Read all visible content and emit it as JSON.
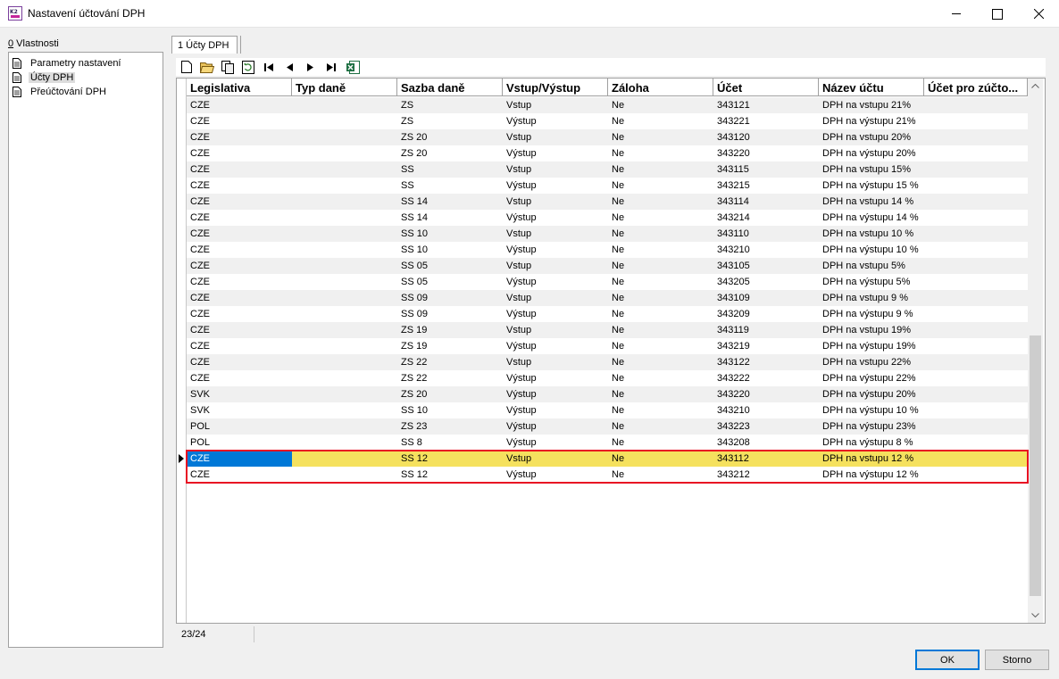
{
  "window": {
    "title": "Nastavení účtování DPH",
    "icon": "k2-app-icon"
  },
  "left_panel": {
    "header_accel": "0",
    "header_text": " Vlastnosti",
    "items": [
      {
        "label": "Parametry nastavení",
        "icon": "document-icon",
        "selected": false
      },
      {
        "label": "Účty DPH",
        "icon": "document-icon",
        "selected": true
      },
      {
        "label": "Přeúčtování DPH",
        "icon": "document-icon",
        "selected": false
      }
    ]
  },
  "tab": {
    "label": "1 Účty DPH"
  },
  "toolbar": {
    "icons": [
      "new-document-icon",
      "open-folder-icon",
      "copy-icon",
      "refresh-icon",
      "first-record-icon",
      "previous-record-icon",
      "next-record-icon",
      "last-record-icon",
      "excel-export-icon"
    ]
  },
  "grid": {
    "columns": [
      "Legislativa",
      "Typ daně",
      "Sazba daně",
      "Vstup/Výstup",
      "Záloha",
      "Účet",
      "Název účtu",
      "Účet pro zúčto..."
    ],
    "rows": [
      [
        "CZE",
        "",
        "ZS",
        "Vstup",
        "Ne",
        "343121",
        "DPH na vstupu 21%",
        ""
      ],
      [
        "CZE",
        "",
        "ZS",
        "Výstup",
        "Ne",
        "343221",
        "DPH na výstupu 21%",
        ""
      ],
      [
        "CZE",
        "",
        "ZS 20",
        "Vstup",
        "Ne",
        "343120",
        "DPH na vstupu 20%",
        ""
      ],
      [
        "CZE",
        "",
        "ZS 20",
        "Výstup",
        "Ne",
        "343220",
        "DPH na výstupu 20%",
        ""
      ],
      [
        "CZE",
        "",
        "SS",
        "Vstup",
        "Ne",
        "343115",
        "DPH na vstupu 15%",
        ""
      ],
      [
        "CZE",
        "",
        "SS",
        "Výstup",
        "Ne",
        "343215",
        "DPH na výstupu 15 %",
        ""
      ],
      [
        "CZE",
        "",
        "SS 14",
        "Vstup",
        "Ne",
        "343114",
        "DPH na vstupu 14 %",
        ""
      ],
      [
        "CZE",
        "",
        "SS 14",
        "Výstup",
        "Ne",
        "343214",
        "DPH na výstupu 14 %",
        ""
      ],
      [
        "CZE",
        "",
        "SS 10",
        "Vstup",
        "Ne",
        "343110",
        "DPH na vstupu 10 %",
        ""
      ],
      [
        "CZE",
        "",
        "SS 10",
        "Výstup",
        "Ne",
        "343210",
        "DPH na výstupu 10 %",
        ""
      ],
      [
        "CZE",
        "",
        "SS 05",
        "Vstup",
        "Ne",
        "343105",
        "DPH na vstupu 5%",
        ""
      ],
      [
        "CZE",
        "",
        "SS 05",
        "Výstup",
        "Ne",
        "343205",
        "DPH na výstupu 5%",
        ""
      ],
      [
        "CZE",
        "",
        "SS 09",
        "Vstup",
        "Ne",
        "343109",
        "DPH na vstupu 9 %",
        ""
      ],
      [
        "CZE",
        "",
        "SS 09",
        "Výstup",
        "Ne",
        "343209",
        "DPH na výstupu 9 %",
        ""
      ],
      [
        "CZE",
        "",
        "ZS 19",
        "Vstup",
        "Ne",
        "343119",
        "DPH na vstupu 19%",
        ""
      ],
      [
        "CZE",
        "",
        "ZS 19",
        "Výstup",
        "Ne",
        "343219",
        "DPH na výstupu 19%",
        ""
      ],
      [
        "CZE",
        "",
        "ZS 22",
        "Vstup",
        "Ne",
        "343122",
        "DPH na vstupu 22%",
        ""
      ],
      [
        "CZE",
        "",
        "ZS 22",
        "Výstup",
        "Ne",
        "343222",
        "DPH na výstupu 22%",
        ""
      ],
      [
        "SVK",
        "",
        "ZS 20",
        "Výstup",
        "Ne",
        "343220",
        "DPH na výstupu 20%",
        ""
      ],
      [
        "SVK",
        "",
        "SS 10",
        "Výstup",
        "Ne",
        "343210",
        "DPH na výstupu 10 %",
        ""
      ],
      [
        "POL",
        "",
        "ZS 23",
        "Výstup",
        "Ne",
        "343223",
        "DPH na výstupu 23%",
        ""
      ],
      [
        "POL",
        "",
        "SS 8",
        "Výstup",
        "Ne",
        "343208",
        "DPH na výstupu 8 %",
        ""
      ],
      [
        "CZE",
        "",
        "SS 12",
        "Vstup",
        "Ne",
        "343112",
        "DPH na vstupu 12 %",
        ""
      ],
      [
        "CZE",
        "",
        "SS 12",
        "Výstup",
        "Ne",
        "343212",
        "DPH na výstupu 12 %",
        ""
      ]
    ],
    "selected_row": 22,
    "selected_color": "#f5e15e",
    "focus_color": "#0078d7",
    "highlight_color": "#e81123"
  },
  "status": {
    "record_position": "23/24"
  },
  "buttons": {
    "ok": "OK",
    "cancel": "Storno"
  }
}
